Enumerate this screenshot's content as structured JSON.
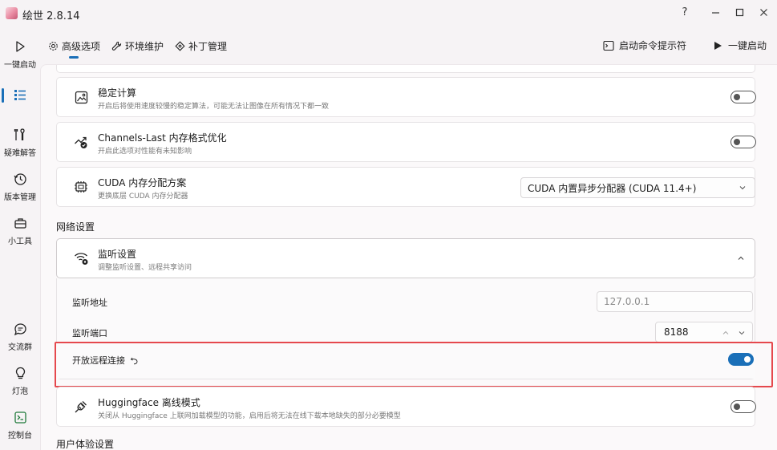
{
  "window": {
    "title": "绘世 2.8.14",
    "help": "?",
    "minimize": "—",
    "maximize": "☐",
    "close": "✕"
  },
  "sidebar": {
    "items": [
      {
        "label": "一键启动",
        "icon": "play-icon"
      },
      {
        "label": "",
        "icon": "list-icon"
      },
      {
        "label": "疑难解答",
        "icon": "tools-icon"
      },
      {
        "label": "版本管理",
        "icon": "history-icon"
      },
      {
        "label": "小工具",
        "icon": "toolbox-icon"
      },
      {
        "label": "交流群",
        "icon": "chat-icon"
      },
      {
        "label": "灯泡",
        "icon": "bulb-icon"
      },
      {
        "label": "控制台",
        "icon": "console-icon"
      }
    ]
  },
  "tabs": [
    {
      "label": "高级选项",
      "icon": "gear-icon"
    },
    {
      "label": "环境维护",
      "icon": "wrench-icon"
    },
    {
      "label": "补丁管理",
      "icon": "puzzle-icon"
    }
  ],
  "header_actions": {
    "console_prompt": "启动命令提示符",
    "launch": "一键启动"
  },
  "cards": {
    "stable": {
      "title": "稳定计算",
      "desc": "开启后将使用速度较慢的稳定算法，可能无法让图像在所有情况下都一致",
      "enabled": false
    },
    "channels_last": {
      "title": "Channels-Last 内存格式优化",
      "desc": "开启此选项对性能有未知影响",
      "enabled": false
    },
    "cuda_alloc": {
      "title": "CUDA 内存分配方案",
      "desc": "更换底层 CUDA 内存分配器",
      "value": "CUDA 内置异步分配器 (CUDA 11.4+)"
    },
    "listen": {
      "title": "监听设置",
      "desc": "调整监听设置、远程共享访问"
    },
    "hf_offline": {
      "title": "Huggingface 离线模式",
      "desc": "关闭从 Huggingface 上联网加载模型的功能，启用后将无法在线下载本地缺失的部分必要模型",
      "enabled": false
    }
  },
  "sections": {
    "network": "网络设置",
    "ux": "用户体验设置"
  },
  "listen_fields": {
    "address_label": "监听地址",
    "address_placeholder": "127.0.0.1",
    "port_label": "监听端口",
    "port_value": "8188",
    "remote_label": "开放远程连接",
    "remote_enabled": true
  },
  "colors": {
    "accent": "#1a6fb8",
    "highlight": "#e5484d"
  }
}
